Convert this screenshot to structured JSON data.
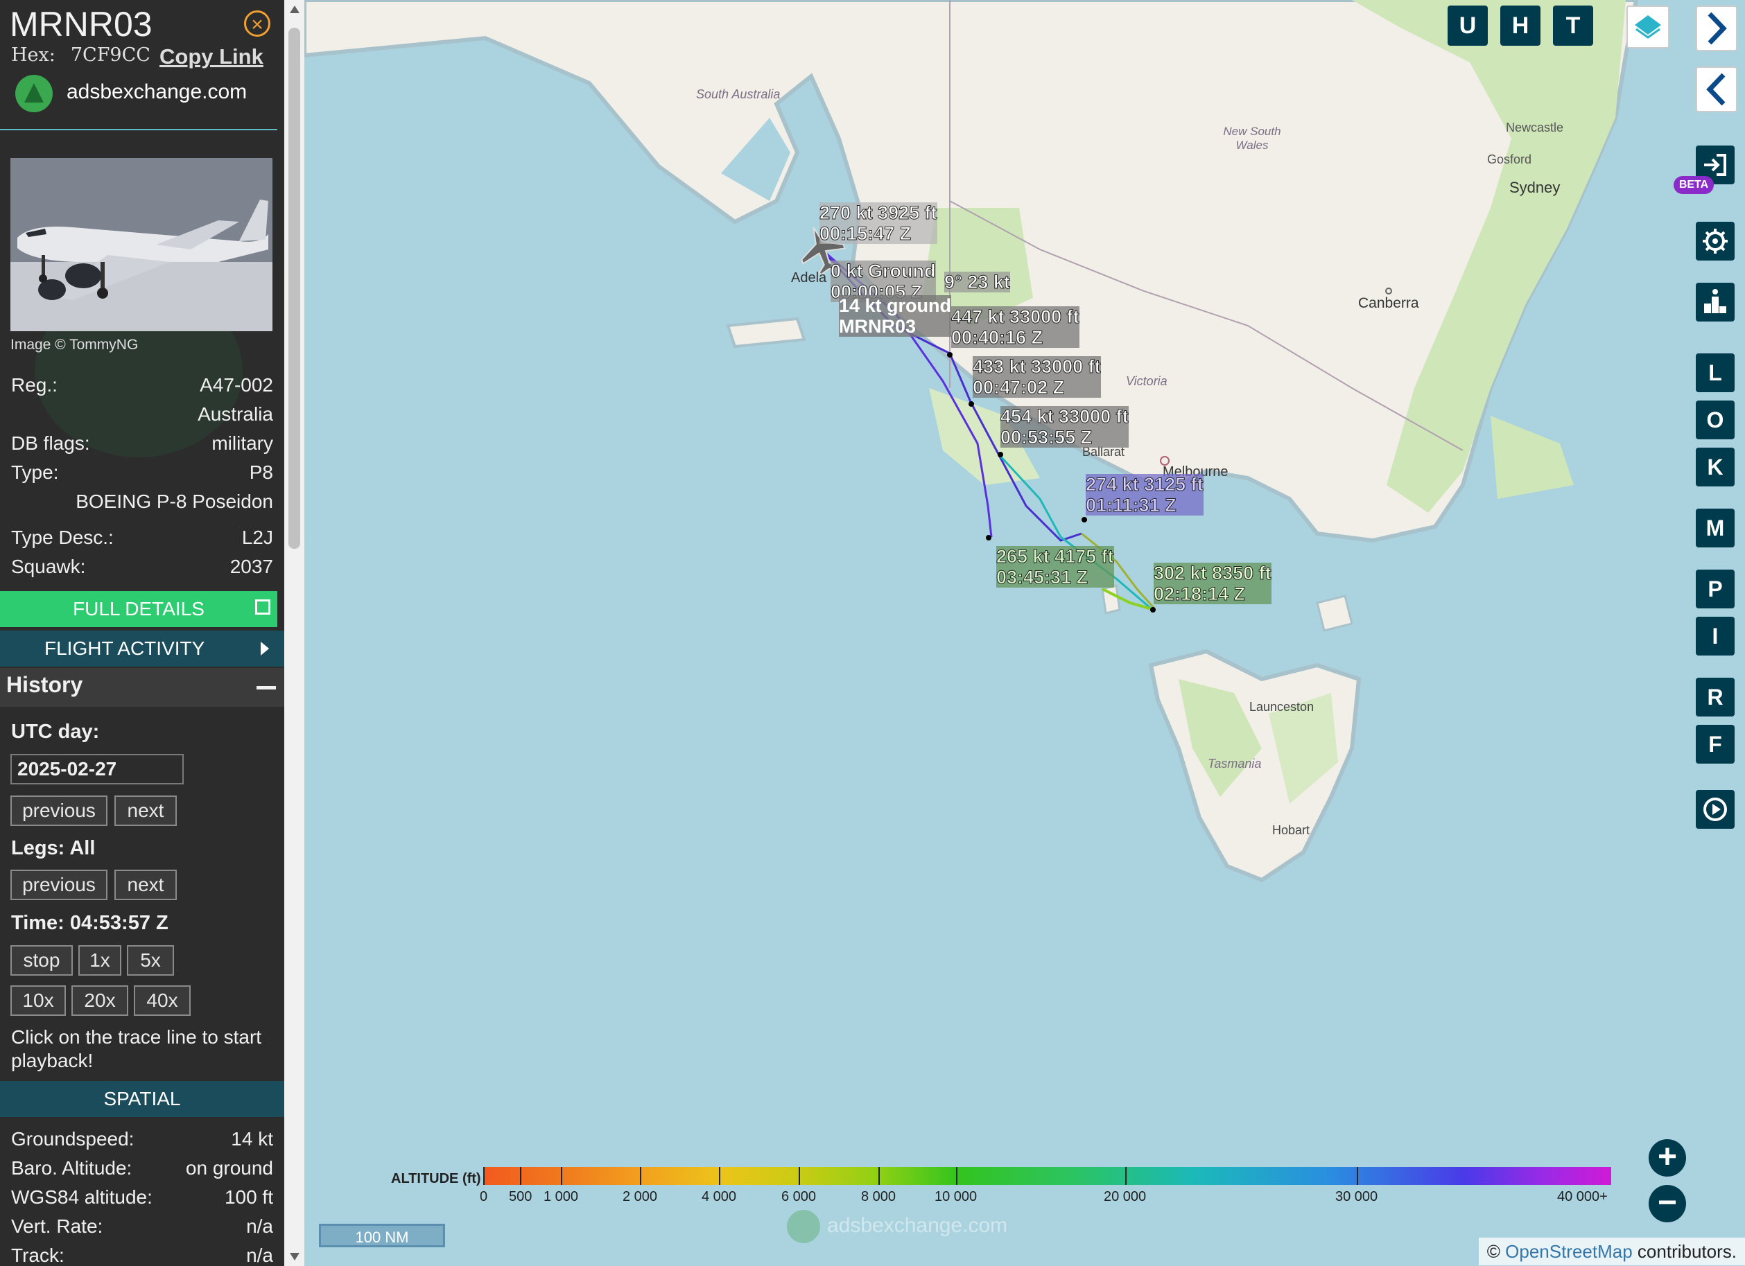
{
  "aircraft": {
    "callsign": "MRNR03",
    "hex_label": "Hex:",
    "hex": "7CF9CC",
    "copy_link": "Copy Link",
    "source": "adsbexchange.com",
    "photo_credit": "Image © TommyNG"
  },
  "details": {
    "reg_label": "Reg.:",
    "reg": "A47-002",
    "country": "Australia",
    "dbflags_label": "DB flags:",
    "dbflags": "military",
    "type_label": "Type:",
    "type": "P8",
    "type_name": "BOEING P-8 Poseidon",
    "typedesc_label": "Type Desc.:",
    "typedesc": "L2J",
    "squawk_label": "Squawk:",
    "squawk": "2037"
  },
  "buttons": {
    "full_details": "FULL DETAILS",
    "flight_activity": "FLIGHT ACTIVITY"
  },
  "history": {
    "title": "History",
    "utc_label": "UTC day:",
    "date": "2025-02-27",
    "prev": "previous",
    "next": "next",
    "legs_label": "Legs: All",
    "time_label": "Time: 04:53:57 Z",
    "stop": "stop",
    "speeds": [
      "1x",
      "5x",
      "10x",
      "20x",
      "40x"
    ],
    "hint": "Click on the trace line to start playback!"
  },
  "spatial": {
    "title": "SPATIAL",
    "gs_label": "Groundspeed:",
    "gs": "14 kt",
    "baro_label": "Baro. Altitude:",
    "baro": "on ground",
    "wgs_label": "WGS84 altitude:",
    "wgs": "100 ft",
    "vr_label": "Vert. Rate:",
    "vr": "n/a",
    "track_label": "Track:",
    "track": "n/a"
  },
  "map": {
    "top_buttons": [
      "U",
      "H",
      "T"
    ],
    "side_buttons": [
      "L",
      "O",
      "K",
      "M",
      "P",
      "I",
      "R",
      "F"
    ],
    "beta": "BETA",
    "places": {
      "south_australia": "South Australia",
      "nsw": "New South Wales",
      "newcastle": "Newcastle",
      "gosford": "Gosford",
      "sydney": "Sydney",
      "canberra": "Canberra",
      "victoria": "Victoria",
      "ballarat": "Ballarat",
      "melbourne": "Melbourne",
      "launceston": "Launceston",
      "tasmania": "Tasmania",
      "hobart": "Hobart",
      "adelaide": "Adela"
    },
    "labels": [
      {
        "l1": "270 kt  3925 ft",
        "l2": "00:15:47 Z"
      },
      {
        "l1": "0 kt  Ground",
        "l2": "00:00:05 Z"
      },
      {
        "l1": "9° 23 kt",
        "l2": ""
      },
      {
        "l1": "14 kt  ground",
        "l2": "MRNR03"
      },
      {
        "l1": "447 kt  33000 ft",
        "l2": "00:40:16 Z"
      },
      {
        "l1": "433 kt  33000 ft",
        "l2": "00:47:02 Z"
      },
      {
        "l1": "454 kt  33000 ft",
        "l2": "00:53:55 Z"
      },
      {
        "l1": "274 kt  3125 ft",
        "l2": "01:11:31 Z"
      },
      {
        "l1": "265 kt  4175 ft",
        "l2": "03:45:31 Z"
      },
      {
        "l1": "302 kt  8350 ft",
        "l2": "02:18:14 Z"
      }
    ],
    "altitude_legend": {
      "title": "ALTITUDE (ft)",
      "ticks": [
        "0",
        "500",
        "1 000",
        "2 000",
        "4 000",
        "6 000",
        "8 000",
        "10 000",
        "20 000",
        "30 000",
        "40 000+"
      ]
    },
    "scale": "100 NM",
    "watermark": "adsbexchange.com",
    "attribution_prefix": "© ",
    "attribution_link": "OpenStreetMap",
    "attribution_suffix": " contributors."
  }
}
